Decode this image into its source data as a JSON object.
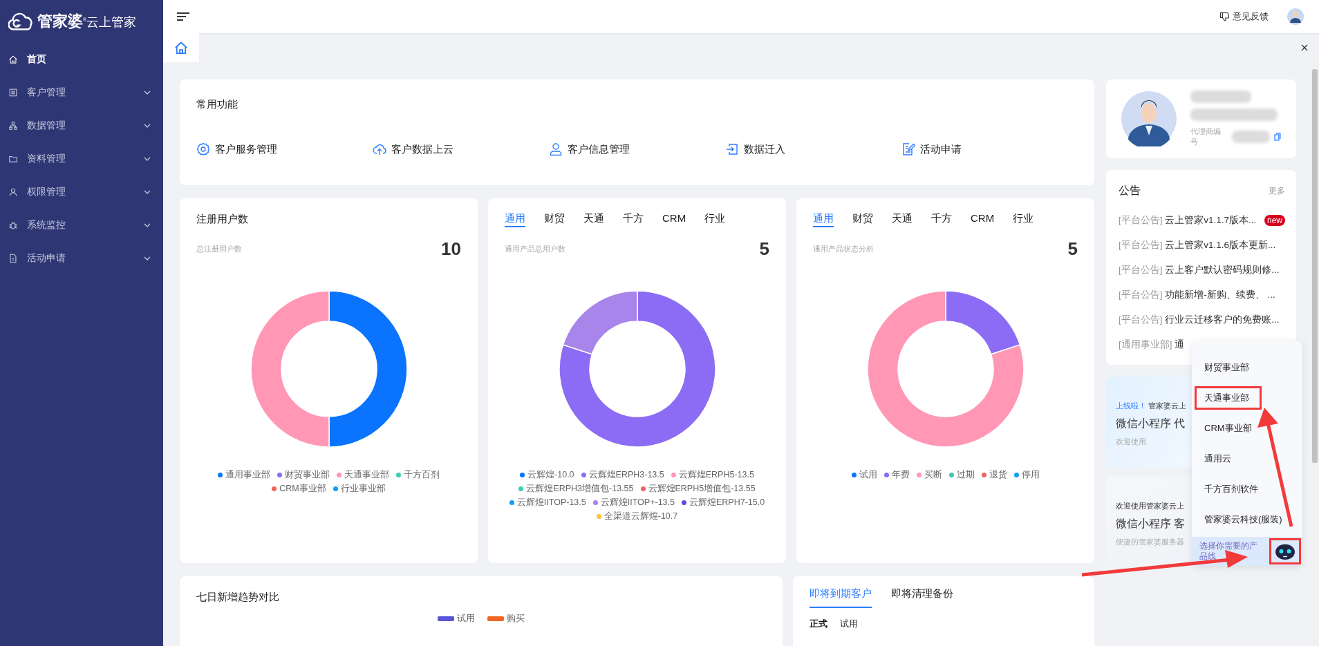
{
  "sidebar": {
    "logo": "**管家婆**$^{®}$云上管家",
    "items": [
      {
        "label": "首页",
        "selected": true,
        "expandable": false
      },
      {
        "label": "客户管理",
        "selected": false,
        "expandable": true
      },
      {
        "label": "数据管理",
        "selected": false,
        "expandable": true
      },
      {
        "label": "资料管理",
        "selected": false,
        "expandable": true
      },
      {
        "label": "权限管理",
        "selected": false,
        "expandable": true
      },
      {
        "label": "系统监控",
        "selected": false,
        "expandable": true
      },
      {
        "label": "活动申请",
        "selected": false,
        "expandable": true
      }
    ]
  },
  "header": {
    "feedback": "意见反馈"
  },
  "common_functions": {
    "title": "常用功能",
    "items": [
      {
        "label": "客户服务管理"
      },
      {
        "label": "客户数据上云"
      },
      {
        "label": "客户信息管理"
      },
      {
        "label": "数据迁入"
      },
      {
        "label": "活动申请"
      }
    ]
  },
  "stat_cards": [
    {
      "title": "注册用户数",
      "subtitle": "总注册用户数",
      "total": "10",
      "chart_data": {
        "type": "donut",
        "categories": [
          "通用事业部",
          "财贸事业部",
          "天通事业部",
          "千方百剂",
          "CRM事业部",
          "行业事业部"
        ],
        "values": [
          50,
          0,
          50,
          0,
          0,
          0
        ],
        "colors": [
          "#0a74ff",
          "#8c6cf5",
          "#ff97b5",
          "#3ecbb1",
          "#f2625e",
          "#0e9ff5"
        ]
      }
    },
    {
      "tabs": [
        {
          "label": "通用",
          "selected": true
        },
        {
          "label": "财贸",
          "selected": false
        },
        {
          "label": "天通",
          "selected": false
        },
        {
          "label": "千方",
          "selected": false
        },
        {
          "label": "CRM",
          "selected": false
        },
        {
          "label": "行业",
          "selected": false
        }
      ],
      "subtitle": "通用产品总用户数",
      "total": "5",
      "chart_data": {
        "type": "donut",
        "categories": [
          "云辉煌-10.0",
          "云辉煌ERPH3-13.5",
          "云辉煌ERPH5-13.5",
          "云辉煌ERPH3增值包-13.55",
          "云辉煌ERPH5增值包-13.55",
          "云辉煌IITOP-13.5",
          "云辉煌IITOP+-13.5",
          "云辉煌ERPH7-15.0",
          "全渠道云辉煌-10.7"
        ],
        "values": [
          0,
          80,
          0,
          0,
          0,
          0,
          20,
          0,
          0
        ],
        "colors": [
          "#0a74ff",
          "#8c6cf5",
          "#ff97b5",
          "#3ecbb1",
          "#f2625e",
          "#0e9ff5",
          "#a885ea",
          "#5b4fd8",
          "#ffc62e"
        ]
      }
    },
    {
      "tabs": [
        {
          "label": "通用",
          "selected": true
        },
        {
          "label": "财贸",
          "selected": false
        },
        {
          "label": "天通",
          "selected": false
        },
        {
          "label": "千方",
          "selected": false
        },
        {
          "label": "CRM",
          "selected": false
        },
        {
          "label": "行业",
          "selected": false
        }
      ],
      "subtitle": "通用产品状态分析",
      "total": "5",
      "chart_data": {
        "type": "donut",
        "categories": [
          "试用",
          "年费",
          "买断",
          "过期",
          "退货",
          "停用"
        ],
        "values": [
          0,
          20,
          80,
          0,
          0,
          0
        ],
        "colors": [
          "#0a74ff",
          "#8c6cf5",
          "#ff97b5",
          "#3ecbb1",
          "#f2625e",
          "#0e9ff5"
        ]
      }
    }
  ],
  "trend": {
    "title": "七日新增趋势对比",
    "legend": [
      {
        "label": "试用",
        "color": "#5a55d6"
      },
      {
        "label": "购买",
        "color": "#f26522"
      }
    ]
  },
  "expiring": {
    "tabs": [
      {
        "label": "即将到期客户",
        "selected": true
      },
      {
        "label": "即将清理备份",
        "selected": false
      }
    ],
    "subtabs": [
      {
        "label": "正式",
        "selected": true
      },
      {
        "label": "试用",
        "selected": false
      }
    ]
  },
  "profile": {
    "agent_label": "代理商编号"
  },
  "notices": {
    "title": "公告",
    "more": "更多",
    "items": [
      {
        "tag": "[平台公告]",
        "title": "云上管家v1.1.7版本...",
        "badge": "new"
      },
      {
        "tag": "[平台公告]",
        "title": "云上管家v1.1.6版本更新..."
      },
      {
        "tag": "[平台公告]",
        "title": "云上客户默认密码规则修..."
      },
      {
        "tag": "[平台公告]",
        "title": "功能新增-新购、续费、 ..."
      },
      {
        "tag": "[平台公告]",
        "title": "行业云迁移客户的免费账..."
      },
      {
        "tag": "[通用事业部]",
        "title": "通"
      }
    ]
  },
  "banners": [
    {
      "kicker": "上线啦！",
      "lead": "管家婆云上",
      "headline": "微信小程序 代",
      "note": "欢迎使用"
    },
    {
      "lead": "欢迎使用管家婆云上",
      "headline": "微信小程序 客",
      "note": "便捷的管家婆服务器"
    }
  ],
  "dropdown": {
    "items": [
      {
        "label": "财贸事业部",
        "highlighted": false
      },
      {
        "label": "天通事业部",
        "highlighted": true
      },
      {
        "label": "CRM事业部",
        "highlighted": false
      },
      {
        "label": "通用云",
        "highlighted": false
      },
      {
        "label": "千方百剂软件",
        "highlighted": false
      },
      {
        "label": "管家婆云科技(服装)",
        "highlighted": false
      }
    ],
    "footer": "选择你需要的产品线",
    "robot_highlighted": true
  }
}
